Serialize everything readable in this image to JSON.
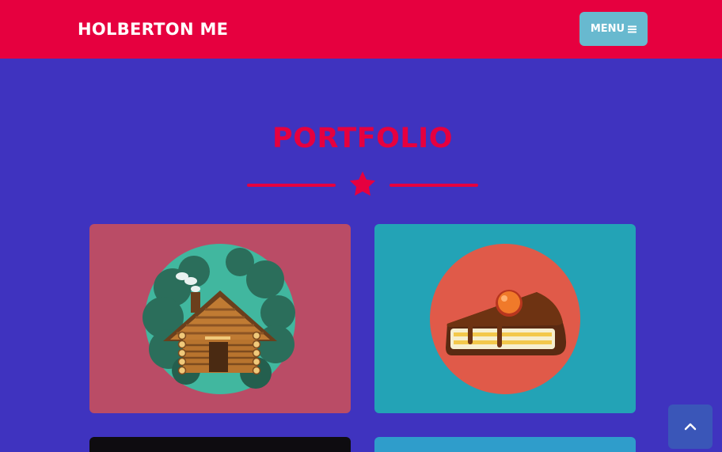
{
  "navbar": {
    "brand": "HOLBERTON ME",
    "menu_label": "MENU",
    "menu_icon": "bars-icon"
  },
  "portfolio": {
    "title": "PORTFOLIO",
    "divider_icon": "star-icon",
    "items": [
      {
        "icon": "log-cabin-icon",
        "background": "#ba4c66"
      },
      {
        "icon": "cake-slice-icon",
        "background": "#23a3b6"
      },
      {
        "icon": "unknown",
        "background": "#0e0c10"
      },
      {
        "icon": "unknown",
        "background": "#2f9dcb"
      }
    ]
  },
  "scroll_top": {
    "icon": "chevron-up-icon"
  },
  "colors": {
    "primary": "#e6003f",
    "page_background": "#3f33bf",
    "menu_button": "#68b9cf",
    "scroll_top_button": "#3a56b8"
  }
}
